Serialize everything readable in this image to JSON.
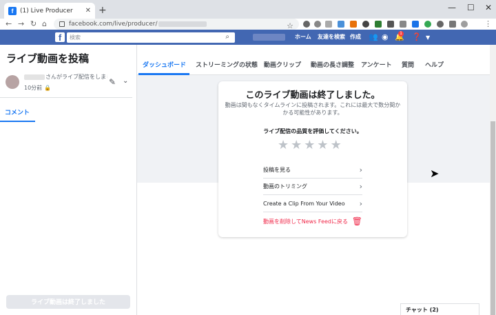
{
  "browser": {
    "tab_title": "(1) Live Producer",
    "tab_favicon": "f",
    "close_tab": "✕",
    "new_tab": "+",
    "url_visible": "facebook.com/live/producer/",
    "window_controls": [
      "—",
      "☐",
      "✕"
    ]
  },
  "fb_header": {
    "logo": "f",
    "search_placeholder": "検索",
    "nav": [
      "ホーム",
      "友達を検索",
      "作成"
    ],
    "notification_count": "1"
  },
  "sidebar": {
    "title": "ライブ動画を投稿",
    "post_action": "さんがライブ配信をしました",
    "post_time": "10分前",
    "comments_tab": "コメント",
    "ended_button": "ライブ動画は終了しました"
  },
  "tabs": [
    "ダッシュボード",
    "ストリーミングの状態",
    "動画クリップ",
    "動画の長さ調整",
    "アンケート",
    "質問",
    "ヘルプ"
  ],
  "card": {
    "heading": "このライブ動画は終了しました。",
    "subtext": "動画は間もなくタイムラインに投稿されます。これには最大で数分間かかる可能性があります。",
    "rate_prompt": "ライブ配信の品質を評価してください。",
    "rating": 0,
    "rating_max": 5,
    "actions": [
      "投稿を見る",
      "動画のトリミング",
      "Create a Clip From Your Video"
    ],
    "delete_action": "動画を削除してNews Feedに戻る"
  },
  "chat": {
    "label": "チャット (2)"
  },
  "colors": {
    "fb_blue": "#4267b2",
    "accent": "#1877f2",
    "danger": "#f02849"
  }
}
